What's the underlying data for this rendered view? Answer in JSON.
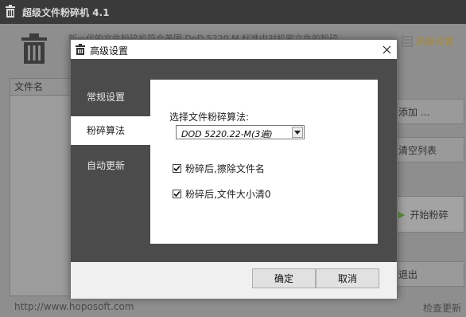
{
  "app": {
    "title": "超级文件粉碎机 4.1",
    "description": "新一代的文件粉碎机符合美国 DoD 5220.M 标准中对机密文件的粉碎",
    "advanced_link": "高级设置",
    "file_list_header": "文件名",
    "buttons": {
      "add": "添加 ...",
      "clear": "清空列表",
      "start": "开始粉碎",
      "exit": "退出"
    },
    "site_url": "http://www.hoposoft.com",
    "check_update": "检查更新"
  },
  "dialog": {
    "title": "高级设置",
    "nav": {
      "general": "常规设置",
      "algorithm": "粉碎算法",
      "auto_update": "自动更新"
    },
    "algorithm_label": "选择文件粉碎算法:",
    "algorithm_selected": "DOD 5220.22-M(3遍)",
    "checkboxes": {
      "erase_name": {
        "label": "粉碎后,擦除文件名",
        "checked": true
      },
      "zero_size": {
        "label": "粉碎后,文件大小清0",
        "checked": true
      }
    },
    "ok": "确定",
    "cancel": "取消"
  },
  "colors": {
    "dialog_nav_bg": "#4b4b4b",
    "accent_link": "#a88a3a",
    "start_arrow": "#5d8b3c"
  }
}
